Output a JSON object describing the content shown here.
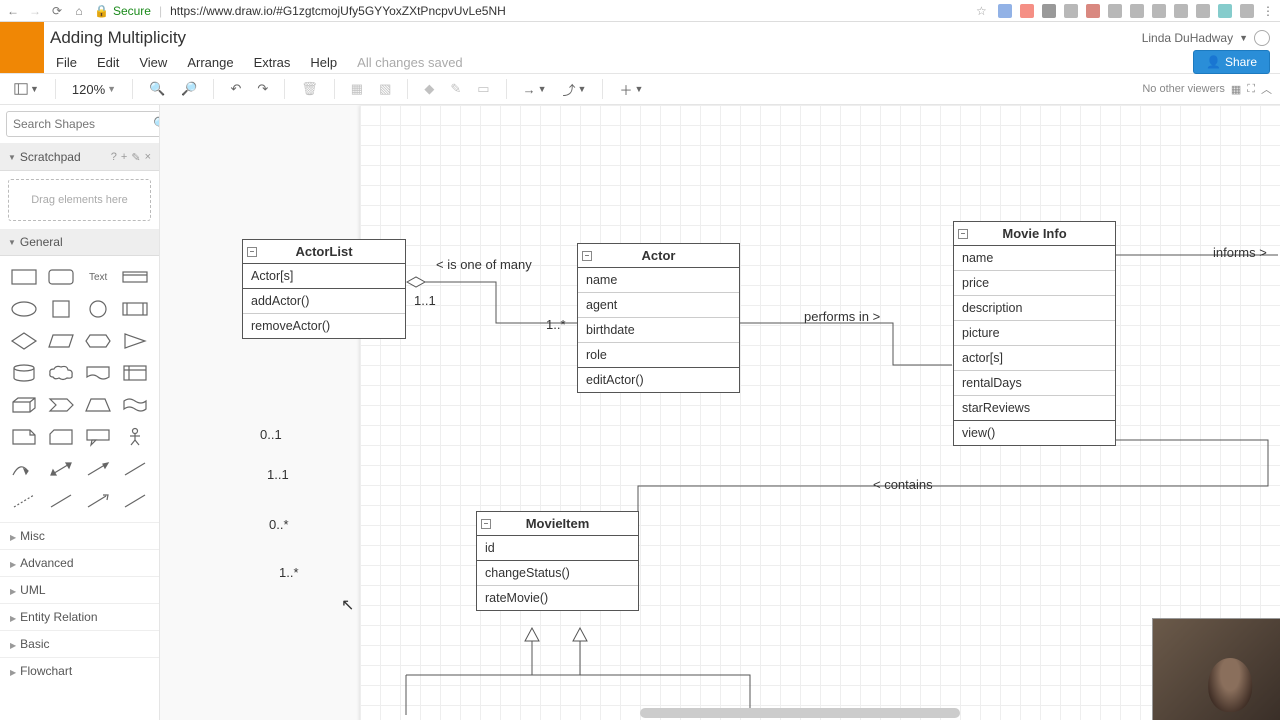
{
  "browser": {
    "secure_label": "Secure",
    "url": "https://www.draw.io/#G1zgtcmojUfy5GYYoxZXtPncpvUvLe5NH"
  },
  "header": {
    "doc_title": "Adding Multiplicity",
    "user_name": "Linda DuHadway",
    "share_label": "Share"
  },
  "menu": {
    "file": "File",
    "edit": "Edit",
    "view": "View",
    "arrange": "Arrange",
    "extras": "Extras",
    "help": "Help",
    "saved": "All changes saved"
  },
  "toolbar": {
    "zoom": "120%",
    "no_viewers": "No other viewers"
  },
  "sidebar": {
    "search_placeholder": "Search Shapes",
    "scratchpad_title": "Scratchpad",
    "scratchpad_drop": "Drag elements here",
    "general_title": "General",
    "text_shape": "Text",
    "cats": {
      "misc": "Misc",
      "advanced": "Advanced",
      "uml": "UML",
      "entity": "Entity Relation",
      "basic": "Basic",
      "flowchart": "Flowchart"
    }
  },
  "diagram": {
    "actorlist": {
      "title": "ActorList",
      "attrs": [
        "Actor[s]"
      ],
      "ops": [
        "addActor()",
        "removeActor()"
      ]
    },
    "actor": {
      "title": "Actor",
      "attrs": [
        "name",
        "agent",
        "birthdate",
        "role"
      ],
      "ops": [
        "editActor()"
      ]
    },
    "movieinfo": {
      "title": "Movie Info",
      "attrs": [
        "name",
        "price",
        "description",
        "picture",
        "actor[s]",
        "rentalDays",
        "starReviews"
      ],
      "ops": [
        "view()"
      ]
    },
    "movieitem": {
      "title": "MovieItem",
      "attrs": [
        "id"
      ],
      "ops": [
        "changeStatus()",
        "rateMovie()"
      ]
    },
    "labels": {
      "is_one_of_many": "< is one of many",
      "m_1_1": "1..1",
      "m_1_star": "1..*",
      "performs_in": "performs in >",
      "contains": "< contains",
      "informs": "informs >",
      "free_0_1": "0..1",
      "free_1_1": "1..1",
      "free_0_star": "0..*",
      "free_1_star": "1..*"
    }
  }
}
